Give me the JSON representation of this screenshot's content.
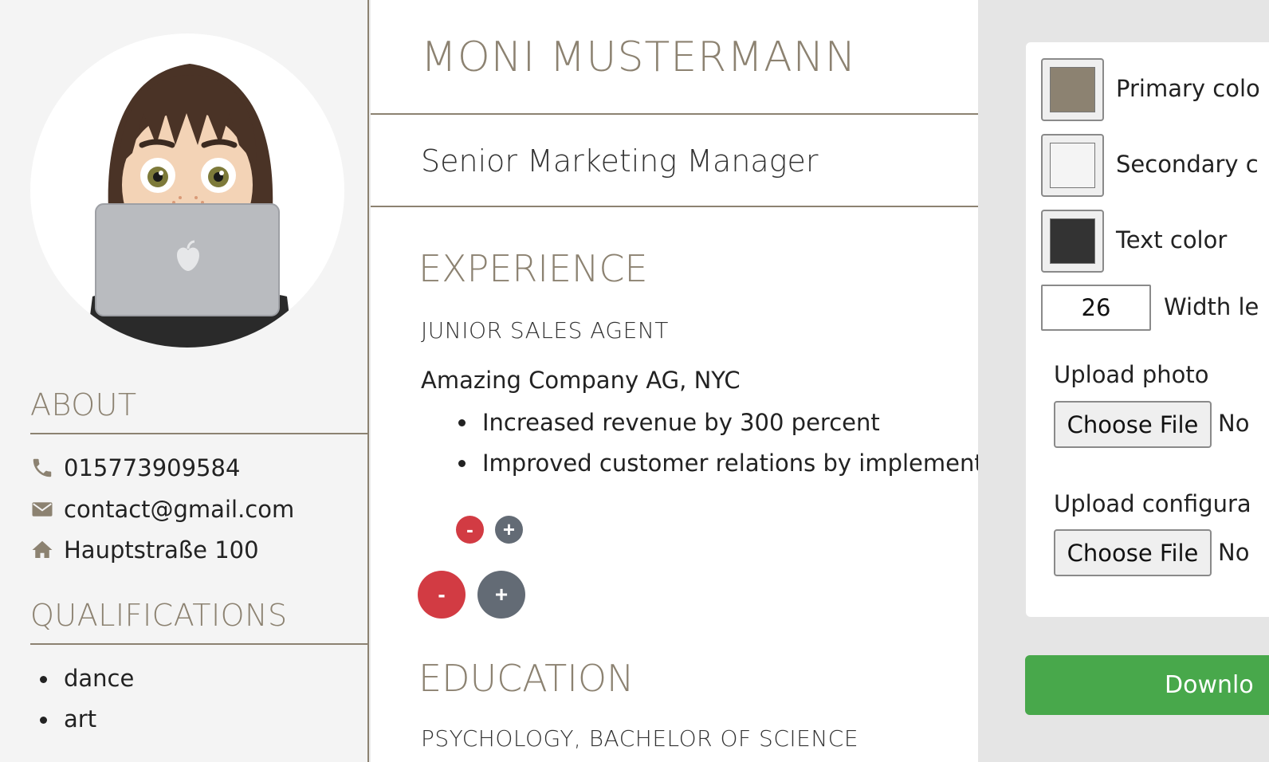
{
  "profile": {
    "name": "MONI MUSTERMANN",
    "job_title": "Senior Marketing Manager"
  },
  "sidebar": {
    "about_heading": "ABOUT",
    "phone": "015773909584",
    "email": "contact@gmail.com",
    "address": "Hauptstraße 100",
    "qualifications_heading": "QUALIFICATIONS",
    "qualifications": [
      "dance",
      "art"
    ]
  },
  "experience": {
    "heading": "EXPERIENCE",
    "position": "JUNIOR SALES AGENT",
    "company": "Amazing Company AG, NYC",
    "bullets": [
      "Increased revenue by 300 percent",
      "Improved customer relations by implementing"
    ],
    "remove_bullet_label": "-",
    "add_bullet_label": "+",
    "remove_entry_label": "-",
    "add_entry_label": "+"
  },
  "education": {
    "heading": "EDUCATION",
    "degree": "PSYCHOLOGY, BACHELOR OF SCIENCE"
  },
  "settings": {
    "primary_color_label": "Primary colo",
    "secondary_color_label": "Secondary c",
    "text_color_label": "Text color",
    "primary_color": "#8c8271",
    "secondary_color": "#f4f4f4",
    "text_color": "#333333",
    "width_value": "26",
    "width_label": "Width le",
    "upload_photo_label": "Upload photo",
    "upload_config_label": "Upload configura",
    "choose_file_label": "Choose File",
    "file_status": "No",
    "download_label": "Downlo"
  }
}
